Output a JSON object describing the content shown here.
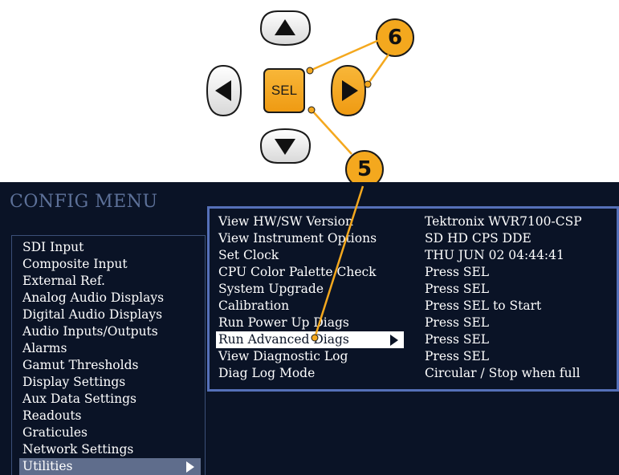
{
  "keypad": {
    "sel_label": "SEL",
    "accent_color": "#f4a81e"
  },
  "callouts": {
    "six": "6",
    "five": "5"
  },
  "config_menu": {
    "title": "CONFIG MENU",
    "items": [
      "SDI Input",
      "Composite Input",
      "External Ref.",
      "Analog Audio Displays",
      "Digital Audio Displays",
      "Audio Inputs/Outputs",
      "Alarms",
      "Gamut Thresholds",
      "Display Settings",
      "Aux Data Settings",
      "Readouts",
      "Graticules",
      "Network Settings",
      "Utilities"
    ],
    "selected_item": "Utilities"
  },
  "utilities": {
    "rows": [
      {
        "label": "View HW/SW Version",
        "value": "Tektronix WVR7100-CSP"
      },
      {
        "label": "View Instrument Options",
        "value": "SD HD CPS DDE"
      },
      {
        "label": "Set Clock",
        "value": "THU JUN 02 04:44:41"
      },
      {
        "label": "CPU Color Palette Check",
        "value": "Press SEL"
      },
      {
        "label": "System Upgrade",
        "value": "Press SEL"
      },
      {
        "label": "Calibration",
        "value": "Press SEL to Start"
      },
      {
        "label": "Run Power Up Diags",
        "value": "Press SEL"
      },
      {
        "label": "Run Advanced Diags",
        "value": "Press SEL"
      },
      {
        "label": "View Diagnostic Log",
        "value": "Press SEL"
      },
      {
        "label": "Diag Log Mode",
        "value": "Circular / Stop when full"
      }
    ],
    "selected_row": "Run Advanced Diags"
  }
}
